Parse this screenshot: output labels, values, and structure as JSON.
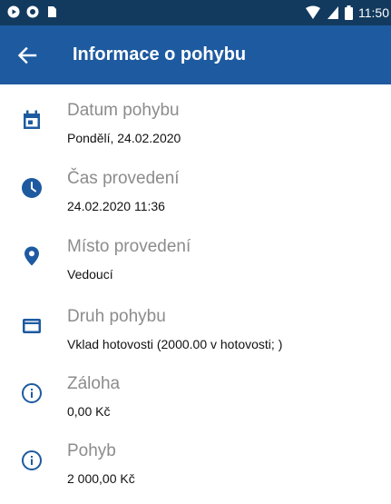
{
  "status_bar": {
    "time": "11:50",
    "icons": [
      "play-protect-icon",
      "circle-icon",
      "sim-icon",
      "wifi-icon",
      "signal-icon",
      "battery-icon"
    ]
  },
  "app_bar": {
    "back_icon": "arrow-back-icon",
    "title": "Informace o pohybu",
    "background_color": "#1e5aa0"
  },
  "details": [
    {
      "icon": "calendar-icon",
      "label": "Datum pohybu",
      "value": "Pondělí, 24.02.2020"
    },
    {
      "icon": "clock-icon",
      "label": "Čas provedení",
      "value": "24.02.2020 11:36"
    },
    {
      "icon": "location-pin-icon",
      "label": "Místo provedení",
      "value": "Vedoucí"
    },
    {
      "icon": "credit-card-icon",
      "label": "Druh pohybu",
      "value": "Vklad hotovosti (2000.00 v hotovosti; )"
    },
    {
      "icon": "info-icon",
      "label": "Záloha",
      "value": "0,00 Kč"
    },
    {
      "icon": "info-icon",
      "label": "Pohyb",
      "value": "2 000,00 Kč"
    }
  ],
  "colors": {
    "icon": "#1e5aa0",
    "status_bar": "#123a5e",
    "label": "#8c8c8c",
    "value": "#111111"
  }
}
